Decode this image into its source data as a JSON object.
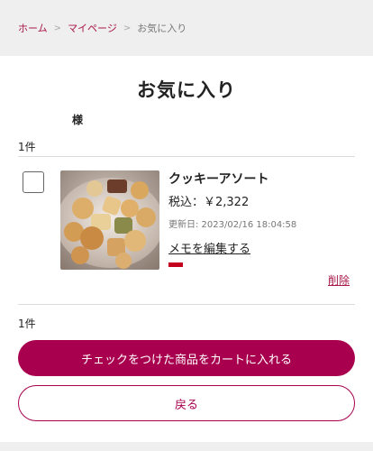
{
  "breadcrumb": {
    "home": "ホーム",
    "sep": ">",
    "mypage": "マイページ",
    "current": "お気に入り"
  },
  "page_title": "お気に入り",
  "user_suffix": "様",
  "list_count": "1件",
  "items": [
    {
      "name": "クッキーアソート",
      "price": "税込：￥2,322",
      "updated": "更新日: 2023/02/16 18:04:58",
      "memo_label": "メモを編集する",
      "delete_label": "削除",
      "checked": false
    }
  ],
  "bottom_count": "1件",
  "cart_button_label": "チェックをつけた商品をカートに入れる",
  "back_button_label": "戻る",
  "colors": {
    "accent": "#a8004e",
    "link": "#a8174a",
    "memo_bar": "#c4001f"
  }
}
